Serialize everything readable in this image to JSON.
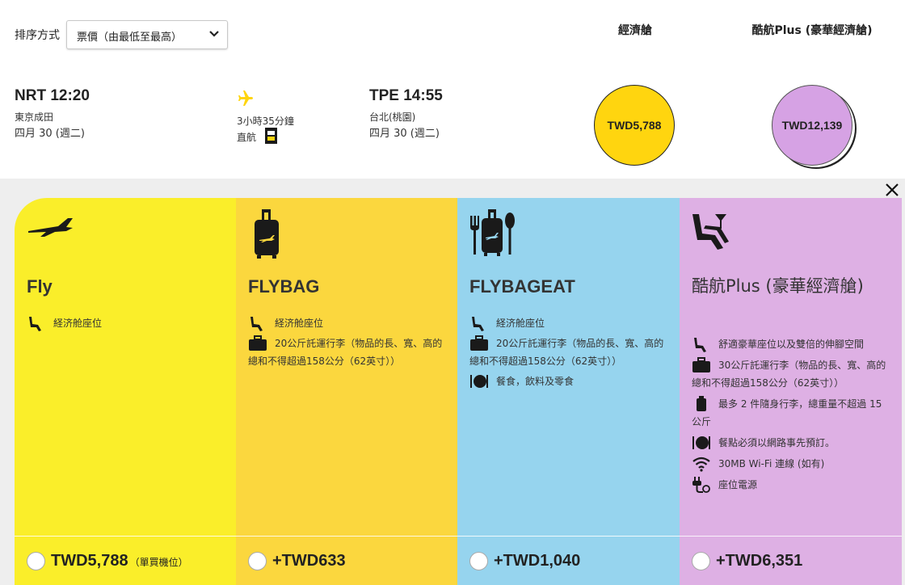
{
  "sort": {
    "label": "排序方式",
    "selected": "票價（由最低至最高）"
  },
  "columns": {
    "economy": "經濟艙",
    "plus": "酷航Plus (豪華經濟艙)"
  },
  "flight": {
    "dep_time": "NRT 12:20",
    "dep_city": "東京成田",
    "dep_date": "四月 30 (週二)",
    "duration": "3小時35分鐘",
    "direct": "直航",
    "arr_time": "TPE 14:55",
    "arr_city": "台北(桃園)",
    "arr_date": "四月 30 (週二)"
  },
  "bubbles": {
    "economy": "TWD5,788",
    "plus": "TWD12,139"
  },
  "fares": [
    {
      "name": "Fly",
      "features": [
        "経济舱座位"
      ],
      "price": "TWD5,788",
      "note": "（單買機位）",
      "color": "#faee2a"
    },
    {
      "name": "FLYBAG",
      "features": [
        "経济舱座位",
        "20公斤託運行李（物品的長、寬、高的總和不得超過158公分（62英寸））"
      ],
      "price": "+TWD633",
      "color": "#fbd73e"
    },
    {
      "name": "FLYBAGEAT",
      "features": [
        "経济舱座位",
        "20公斤託運行李（物品的長、寬、高的總和不得超過158公分（62英寸））",
        "餐食，飲料及零食"
      ],
      "price": "+TWD1,040",
      "color": "#96d4ee"
    },
    {
      "name": "酷航Plus (豪華經濟艙)",
      "features": [
        "舒適豪華座位以及雙倍的伸腳空間",
        "30公斤託運行李（物品的長、寬、高的總和不得超過158公分（62英寸））",
        "最多 2 件隨身行李，總重量不超過 15 公斤",
        "餐點必須以網路事先預訂。",
        "30MB Wi-Fi 連線 (如有)",
        "座位電源"
      ],
      "price": "+TWD6,351",
      "color": "#deb0e4"
    }
  ],
  "colors": {
    "accent_yellow": "#ffd50f",
    "plus_purple": "#d6a2e4",
    "panel_bg": "#eeeeee"
  }
}
